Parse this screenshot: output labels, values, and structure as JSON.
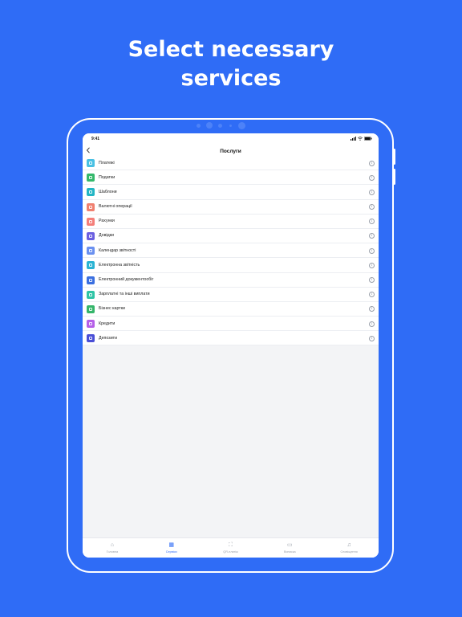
{
  "headline": {
    "line1": "Select necessary",
    "line2": "services"
  },
  "status": {
    "time": "9:41",
    "icons": [
      "signal-icon",
      "wifi-icon",
      "battery-icon"
    ]
  },
  "nav": {
    "title": "Послуги",
    "back_icon": "chevron-left-icon"
  },
  "services": [
    {
      "label": "Платежі",
      "color": "#49c0e3"
    },
    {
      "label": "Податки",
      "color": "#34b86b"
    },
    {
      "label": "Шаблони",
      "color": "#23b5c4"
    },
    {
      "label": "Валютні операції",
      "color": "#f08070"
    },
    {
      "label": "Рахунки",
      "color": "#f47f7a"
    },
    {
      "label": "Довідки",
      "color": "#6b5fe0"
    },
    {
      "label": "Календар звітності",
      "color": "#6a90f0"
    },
    {
      "label": "Електронна звітність",
      "color": "#2ab3d3"
    },
    {
      "label": "Електронний документообіг",
      "color": "#3b6fe0"
    },
    {
      "label": "Зарплатні та інші виплати",
      "color": "#2fc4a6"
    },
    {
      "label": "Бізнес картки",
      "color": "#35b56a"
    },
    {
      "label": "Кредити",
      "color": "#b660e8"
    },
    {
      "label": "Депозити",
      "color": "#4a4fd6"
    }
  ],
  "tabs": [
    {
      "label": "Головна",
      "icon": "home-icon",
      "active": false
    },
    {
      "label": "Сервіси",
      "icon": "grid-icon",
      "active": true
    },
    {
      "label": "QR-платіж",
      "icon": "qr-scan-icon",
      "active": false
    },
    {
      "label": "Виписка",
      "icon": "inbox-icon",
      "active": false
    },
    {
      "label": "Сповіщення",
      "icon": "bell-icon",
      "active": false
    }
  ],
  "colors": {
    "background": "#2f6cf6",
    "accent": "#2f6cf6"
  }
}
